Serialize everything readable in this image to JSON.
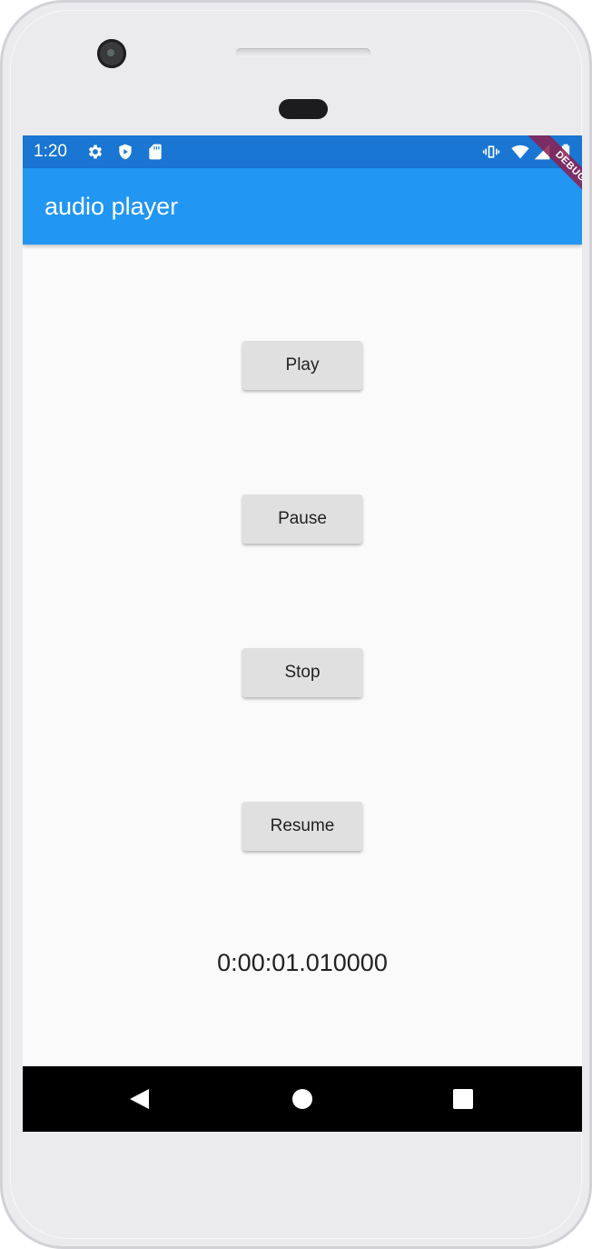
{
  "status_bar": {
    "time": "1:20",
    "icons_left": [
      "gear-icon",
      "shield-icon",
      "sd-card-icon"
    ],
    "icons_right": [
      "vibrate-icon",
      "wifi-icon",
      "signal-icon",
      "battery-icon"
    ],
    "color": "#1976d2"
  },
  "app_bar": {
    "title": "audio player",
    "color": "#2196f3"
  },
  "debug_banner": {
    "label": "DEBUG"
  },
  "buttons": [
    {
      "label": "Play"
    },
    {
      "label": "Pause"
    },
    {
      "label": "Stop"
    },
    {
      "label": "Resume"
    }
  ],
  "position_display": "0:00:01.010000",
  "nav_bar": {
    "buttons": [
      "back-icon",
      "home-icon",
      "recents-icon"
    ]
  }
}
